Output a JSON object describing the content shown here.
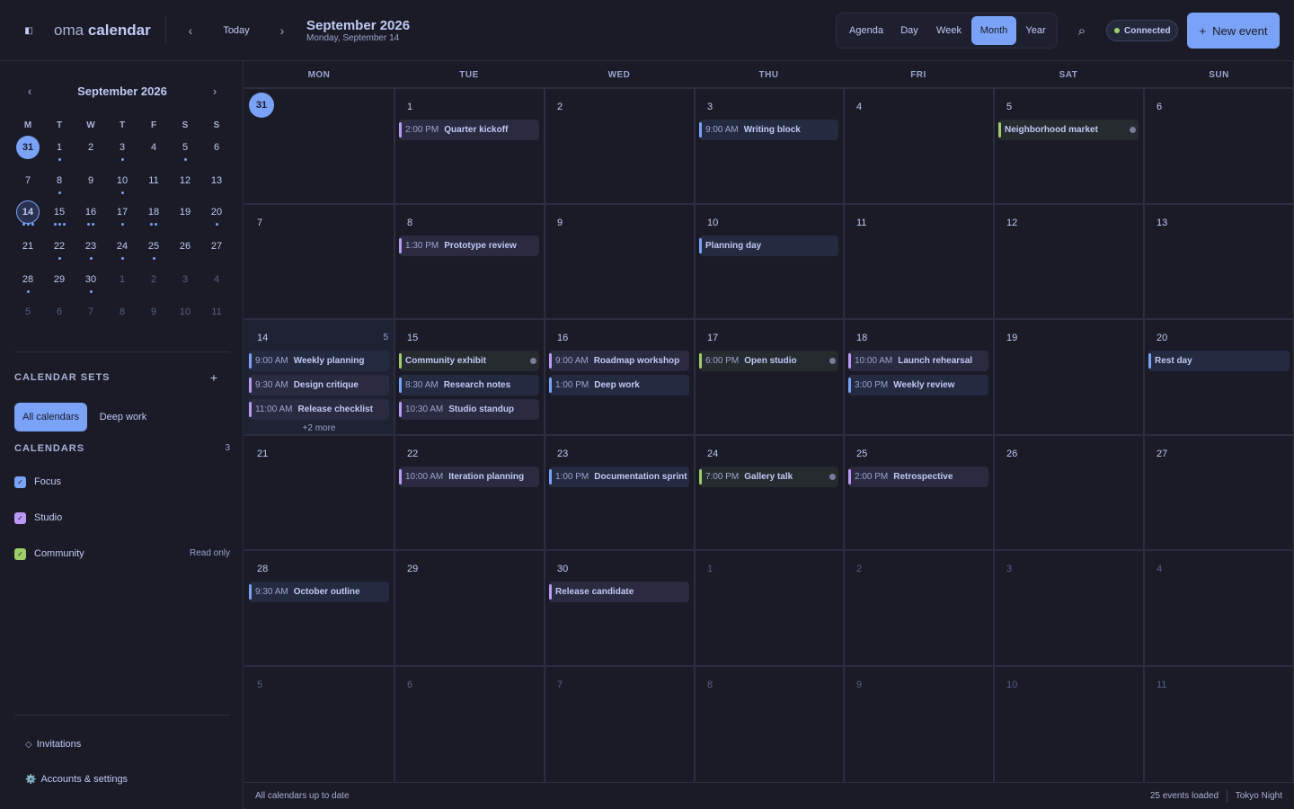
{
  "app": {
    "brand_prefix": "oma",
    "brand_name": "calendar"
  },
  "header": {
    "prev": "‹",
    "today": "Today",
    "next": "›",
    "title": "September 2026",
    "subtitle": "Monday, September 14",
    "views": [
      "Agenda",
      "Day",
      "Week",
      "Month",
      "Year"
    ],
    "active_view": "Month",
    "search_icon": "⌕",
    "status": "Connected",
    "new_event_plus": "+",
    "new_event": "New event"
  },
  "colors": {
    "accent": "#7aa2f7",
    "focus": "#7aa2f7",
    "studio": "#bb9af7",
    "community": "#9ece6a",
    "connected": "#9ece6a"
  },
  "mini": {
    "prev": "‹",
    "title": "September 2026",
    "next": "›",
    "weekdays": [
      "M",
      "T",
      "W",
      "T",
      "F",
      "S",
      "S"
    ],
    "weeks": [
      [
        {
          "d": "31",
          "s": "selected"
        },
        {
          "d": "1",
          "dots": 1
        },
        {
          "d": "2"
        },
        {
          "d": "3",
          "dots": 1
        },
        {
          "d": "4"
        },
        {
          "d": "5",
          "dots": 1
        },
        {
          "d": "6"
        }
      ],
      [
        {
          "d": "7"
        },
        {
          "d": "8",
          "dots": 1
        },
        {
          "d": "9"
        },
        {
          "d": "10",
          "dots": 1
        },
        {
          "d": "11"
        },
        {
          "d": "12"
        },
        {
          "d": "13"
        }
      ],
      [
        {
          "d": "14",
          "s": "today",
          "dots": 3
        },
        {
          "d": "15",
          "dots": 3
        },
        {
          "d": "16",
          "dots": 2
        },
        {
          "d": "17",
          "dots": 1
        },
        {
          "d": "18",
          "dots": 2
        },
        {
          "d": "19"
        },
        {
          "d": "20",
          "dots": 1
        }
      ],
      [
        {
          "d": "21"
        },
        {
          "d": "22",
          "dots": 1
        },
        {
          "d": "23",
          "dots": 1
        },
        {
          "d": "24",
          "dots": 1
        },
        {
          "d": "25",
          "dots": 1
        },
        {
          "d": "26"
        },
        {
          "d": "27"
        }
      ],
      [
        {
          "d": "28",
          "dots": 1
        },
        {
          "d": "29"
        },
        {
          "d": "30",
          "dots": 1
        },
        {
          "d": "1",
          "o": true
        },
        {
          "d": "2",
          "o": true
        },
        {
          "d": "3",
          "o": true
        },
        {
          "d": "4",
          "o": true
        }
      ],
      [
        {
          "d": "5",
          "o": true
        },
        {
          "d": "6",
          "o": true
        },
        {
          "d": "7",
          "o": true
        },
        {
          "d": "8",
          "o": true
        },
        {
          "d": "9",
          "o": true
        },
        {
          "d": "10",
          "o": true
        },
        {
          "d": "11",
          "o": true
        }
      ]
    ]
  },
  "sidebar": {
    "sets_label": "CALENDAR SETS",
    "sets_add": "+",
    "sets": [
      "All calendars",
      "Deep work"
    ],
    "active_set": "All calendars",
    "calendars_label": "CALENDARS",
    "calendars_count": "3",
    "calendars": [
      {
        "name": "Focus",
        "color": "#7aa2f7",
        "checked": true,
        "readonly": ""
      },
      {
        "name": "Studio",
        "color": "#bb9af7",
        "checked": true,
        "readonly": ""
      },
      {
        "name": "Community",
        "color": "#9ece6a",
        "checked": true,
        "readonly": "Read only"
      }
    ],
    "check_glyph": "✓",
    "invitations_icon": "◇",
    "invitations": "Invitations",
    "settings_icon": "⚙️",
    "settings": "Accounts & settings"
  },
  "month": {
    "weekdays": [
      "MON",
      "TUE",
      "WED",
      "THU",
      "FRI",
      "SAT",
      "SUN"
    ],
    "weeks": [
      [
        {
          "d": "31",
          "sel": true
        },
        {
          "d": "1",
          "events": [
            {
              "time": "2:00 PM",
              "name": "Quarter kickoff",
              "cal": "studio"
            }
          ]
        },
        {
          "d": "2"
        },
        {
          "d": "3",
          "events": [
            {
              "time": "9:00 AM",
              "name": "Writing block",
              "cal": "focus"
            }
          ]
        },
        {
          "d": "4"
        },
        {
          "d": "5",
          "events": [
            {
              "time": "",
              "name": "Neighborhood market",
              "cal": "community",
              "ro": true
            }
          ]
        },
        {
          "d": "6"
        }
      ],
      [
        {
          "d": "7"
        },
        {
          "d": "8",
          "events": [
            {
              "time": "1:30 PM",
              "name": "Prototype review",
              "cal": "studio"
            }
          ]
        },
        {
          "d": "9"
        },
        {
          "d": "10",
          "events": [
            {
              "time": "",
              "name": "Planning day",
              "cal": "focus"
            }
          ]
        },
        {
          "d": "11"
        },
        {
          "d": "12"
        },
        {
          "d": "13"
        }
      ],
      [
        {
          "d": "14",
          "hl": true,
          "count": "5",
          "more": "+2 more",
          "events": [
            {
              "time": "9:00 AM",
              "name": "Weekly planning",
              "cal": "focus"
            },
            {
              "time": "9:30 AM",
              "name": "Design critique",
              "cal": "studio"
            },
            {
              "time": "11:00 AM",
              "name": "Release checklist",
              "cal": "studio"
            }
          ]
        },
        {
          "d": "15",
          "events": [
            {
              "time": "",
              "name": "Community exhibit",
              "cal": "community",
              "ro": true
            },
            {
              "time": "8:30 AM",
              "name": "Research notes",
              "cal": "focus"
            },
            {
              "time": "10:30 AM",
              "name": "Studio standup",
              "cal": "studio"
            }
          ]
        },
        {
          "d": "16",
          "events": [
            {
              "time": "9:00 AM",
              "name": "Roadmap workshop",
              "cal": "studio"
            },
            {
              "time": "1:00 PM",
              "name": "Deep work",
              "cal": "focus"
            }
          ]
        },
        {
          "d": "17",
          "events": [
            {
              "time": "6:00 PM",
              "name": "Open studio",
              "cal": "community",
              "ro": true
            }
          ]
        },
        {
          "d": "18",
          "events": [
            {
              "time": "10:00 AM",
              "name": "Launch rehearsal",
              "cal": "studio"
            },
            {
              "time": "3:00 PM",
              "name": "Weekly review",
              "cal": "focus"
            }
          ]
        },
        {
          "d": "19"
        },
        {
          "d": "20",
          "events": [
            {
              "time": "",
              "name": "Rest day",
              "cal": "focus"
            }
          ]
        }
      ],
      [
        {
          "d": "21"
        },
        {
          "d": "22",
          "events": [
            {
              "time": "10:00 AM",
              "name": "Iteration planning",
              "cal": "studio"
            }
          ]
        },
        {
          "d": "23",
          "events": [
            {
              "time": "1:00 PM",
              "name": "Documentation sprint",
              "cal": "focus"
            }
          ]
        },
        {
          "d": "24",
          "events": [
            {
              "time": "7:00 PM",
              "name": "Gallery talk",
              "cal": "community",
              "ro": true
            }
          ]
        },
        {
          "d": "25",
          "events": [
            {
              "time": "2:00 PM",
              "name": "Retrospective",
              "cal": "studio"
            }
          ]
        },
        {
          "d": "26"
        },
        {
          "d": "27"
        }
      ],
      [
        {
          "d": "28",
          "events": [
            {
              "time": "9:30 AM",
              "name": "October outline",
              "cal": "focus"
            }
          ]
        },
        {
          "d": "29"
        },
        {
          "d": "30",
          "events": [
            {
              "time": "",
              "name": "Release candidate",
              "cal": "studio"
            }
          ]
        },
        {
          "d": "1",
          "o": true
        },
        {
          "d": "2",
          "o": true
        },
        {
          "d": "3",
          "o": true
        },
        {
          "d": "4",
          "o": true
        }
      ],
      [
        {
          "d": "5",
          "o": true
        },
        {
          "d": "6",
          "o": true
        },
        {
          "d": "7",
          "o": true
        },
        {
          "d": "8",
          "o": true
        },
        {
          "d": "9",
          "o": true
        },
        {
          "d": "10",
          "o": true
        },
        {
          "d": "11",
          "o": true
        }
      ]
    ]
  },
  "status": {
    "left": "All calendars up to date",
    "count": "25 events loaded",
    "theme": "Tokyo Night"
  }
}
